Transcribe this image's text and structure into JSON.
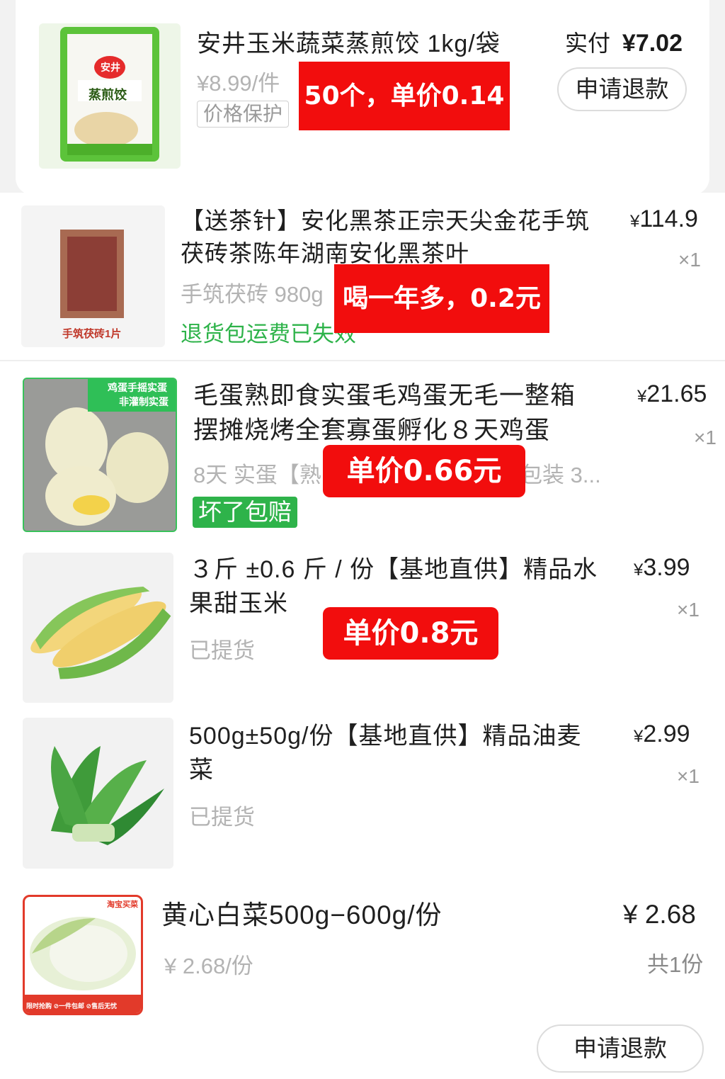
{
  "items": [
    {
      "title": "安井玉米蔬菜蒸煎饺 1kg/袋",
      "unit_price": "¥8.99/件",
      "tag": "价格保护",
      "paid_label": "实付",
      "paid": "¥7.02",
      "button": "申请退款",
      "overlay": "50个，单价0.14元",
      "thumb_text": "蒸煎饺",
      "thumb_brand": "安井"
    },
    {
      "title_line1": "【送茶针】安化黑茶正宗天尖金花手筑",
      "title_line2": "茯砖茶陈年湖南安化黑茶叶",
      "spec": "手筑茯砖 980g",
      "status": "退货包运费已失效",
      "price_yen": "¥",
      "price": "114.9",
      "qty": "×1",
      "overlay": "喝一年多，0.2元",
      "thumb_text": "手筑茯砖1片"
    },
    {
      "title_line1": "毛蛋熟即食实蛋毛鸡蛋无毛一整箱",
      "title_line2": "摆摊烧烤全套寡蛋孵化８天鸡蛋",
      "spec": "8天 实蛋【熟",
      "spec_tail": "包装 3...",
      "tag": "坏了包赔",
      "price_yen": "¥",
      "price": "21.65",
      "qty": "×1",
      "overlay": "单价0.66元",
      "thumb_text1": "鸡蛋手摇实蛋",
      "thumb_text2": "非灌制实蛋"
    },
    {
      "title_line1": "３斤 ±0.6 斤 / 份【基地直供】精品水",
      "title_line2": "果甜玉米",
      "status": "已提货",
      "price_yen": "¥",
      "price": "3.99",
      "qty": "×1",
      "overlay": "单价0.8元"
    },
    {
      "title_line1": "500g±50g/份【基地直供】精品油麦",
      "title_line2": "菜",
      "status": "已提货",
      "price_yen": "¥",
      "price": "2.99",
      "qty": "×1"
    },
    {
      "title": "黄心白菜500g−600g/份",
      "unit_price": "¥ 2.68/份",
      "price": "¥ 2.68",
      "qty": "共1份",
      "button": "申请退款",
      "thumb_badge": "淘宝买菜",
      "thumb_footer": "限时抢购  ⊘一件包邮  ⊘售后无忧"
    }
  ],
  "colors": {
    "accent_red": "#f20d0d",
    "green": "#2eb34a"
  }
}
